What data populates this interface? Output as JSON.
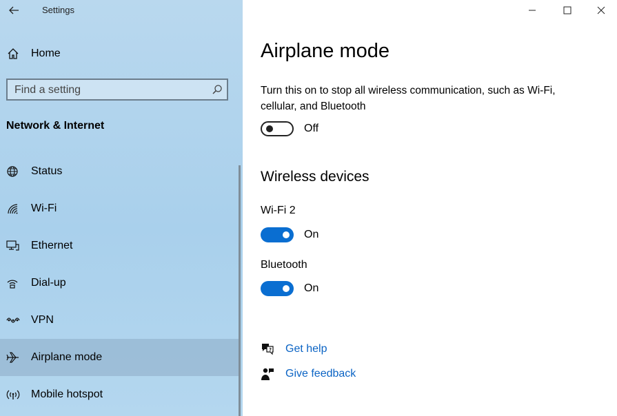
{
  "app": {
    "title": "Settings"
  },
  "sidebar": {
    "home_label": "Home",
    "search_placeholder": "Find a setting",
    "section_title": "Network & Internet",
    "items": [
      {
        "label": "Status",
        "icon": "globe-icon"
      },
      {
        "label": "Wi-Fi",
        "icon": "wifi-icon"
      },
      {
        "label": "Ethernet",
        "icon": "ethernet-icon"
      },
      {
        "label": "Dial-up",
        "icon": "dialup-icon"
      },
      {
        "label": "VPN",
        "icon": "vpn-icon"
      },
      {
        "label": "Airplane mode",
        "icon": "airplane-icon",
        "active": true
      },
      {
        "label": "Mobile hotspot",
        "icon": "hotspot-icon"
      }
    ]
  },
  "main": {
    "title": "Airplane mode",
    "description": "Turn this on to stop all wireless communication, such as Wi-Fi, cellular, and Bluetooth",
    "airplane_toggle": {
      "state": "Off"
    },
    "wireless_title": "Wireless devices",
    "devices": [
      {
        "label": "Wi-Fi 2",
        "state": "On"
      },
      {
        "label": "Bluetooth",
        "state": "On"
      }
    ],
    "links": {
      "help": "Get help",
      "feedback": "Give feedback"
    }
  },
  "colors": {
    "accent": "#0a6ed1",
    "link": "#0a63c4",
    "sidebar": "#b0d4ee"
  }
}
